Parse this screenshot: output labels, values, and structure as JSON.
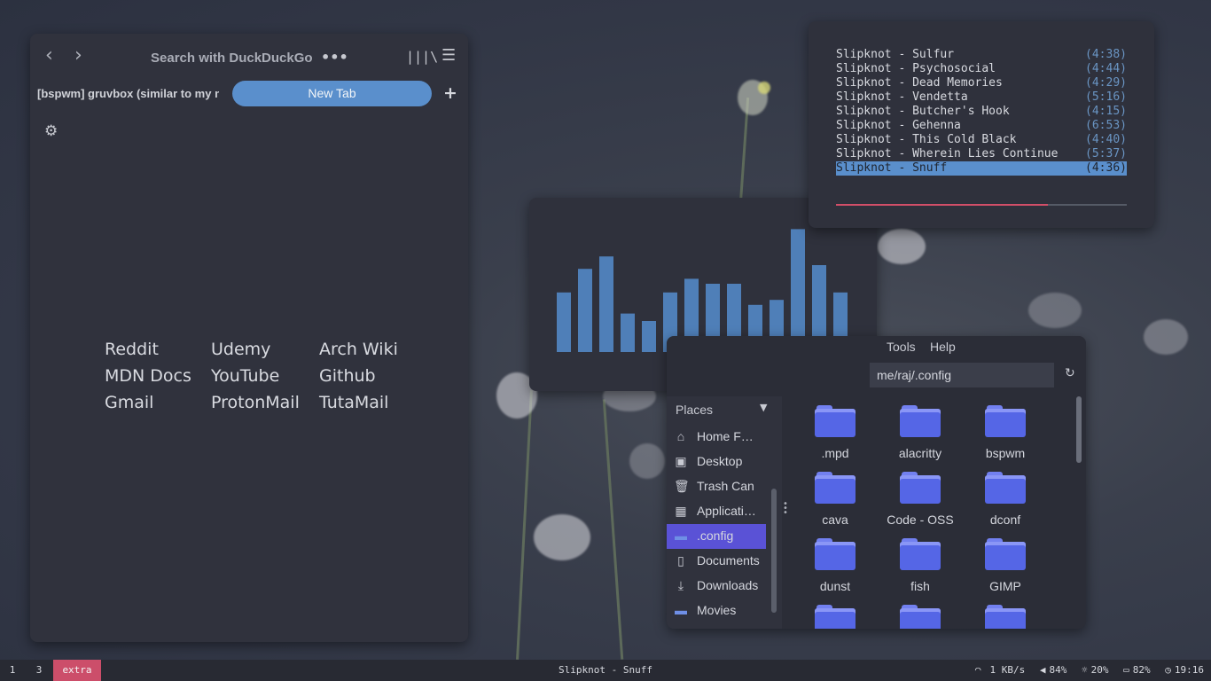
{
  "browser": {
    "search_placeholder": "Search with DuckDuckGo",
    "more_label": "•••",
    "tab_title": "[bspwm] gruvbox (similar to my n",
    "new_tab_label": "New Tab",
    "links": [
      "Reddit",
      "Udemy",
      "Arch Wiki",
      "MDN Docs",
      "YouTube",
      "Github",
      "Gmail",
      "ProtonMail",
      "TutaMail"
    ]
  },
  "player": {
    "tracks": [
      {
        "title": "Slipknot - Sulfur",
        "duration": "(4:38)"
      },
      {
        "title": "Slipknot - Psychosocial",
        "duration": "(4:44)"
      },
      {
        "title": "Slipknot - Dead Memories",
        "duration": "(4:29)"
      },
      {
        "title": "Slipknot - Vendetta",
        "duration": "(5:16)"
      },
      {
        "title": "Slipknot - Butcher's Hook",
        "duration": "(4:15)"
      },
      {
        "title": "Slipknot - Gehenna",
        "duration": "(6:53)"
      },
      {
        "title": "Slipknot - This Cold Black",
        "duration": "(4:40)"
      },
      {
        "title": "Slipknot - Wherein Lies Continue",
        "duration": "(5:37)"
      },
      {
        "title": "Slipknot - Snuff",
        "duration": "(4:36)"
      }
    ],
    "active_index": 8,
    "progress": 0.73,
    "accent": "#5a8fcc",
    "progress_color": "#d24e68"
  },
  "visualizer": {
    "levels": [
      0.48,
      0.67,
      0.77,
      0.31,
      0.25,
      0.48,
      0.59,
      0.55,
      0.55,
      0.38,
      0.42,
      0.99,
      0.7,
      0.48
    ],
    "bar_color": "#4f7fb8"
  },
  "file_manager": {
    "menu": [
      "Tools",
      "Help"
    ],
    "path": "me/raj/.config",
    "places_label": "Places",
    "places": [
      {
        "label": "Home F…",
        "icon": "home-icon",
        "selected": false
      },
      {
        "label": "Desktop",
        "icon": "desktop-icon",
        "selected": false
      },
      {
        "label": "Trash Can",
        "icon": "trash-icon",
        "selected": false
      },
      {
        "label": "Applicati…",
        "icon": "apps-icon",
        "selected": false
      },
      {
        "label": ".config",
        "icon": "folder-icon",
        "selected": true
      },
      {
        "label": "Documents",
        "icon": "document-icon",
        "selected": false
      },
      {
        "label": "Downloads",
        "icon": "download-icon",
        "selected": false
      },
      {
        "label": "Movies",
        "icon": "folder-icon",
        "selected": false
      }
    ],
    "folders": [
      ".mpd",
      "alacritty",
      "bspwm",
      "cava",
      "Code - OSS",
      "dconf",
      "dunst",
      "fish",
      "GIMP",
      "",
      "",
      ""
    ],
    "folder_color": "#5566e6",
    "selected_color": "#5a52d6"
  },
  "statusbar": {
    "workspaces": [
      "1",
      "3",
      "extra"
    ],
    "active_workspace": "extra",
    "now_playing": "Slipknot - Snuff",
    "net": "1 KB/s",
    "volume": "84%",
    "brightness": "20%",
    "battery": "82%",
    "clock": "19:16",
    "active_color": "#cc4e6a"
  }
}
